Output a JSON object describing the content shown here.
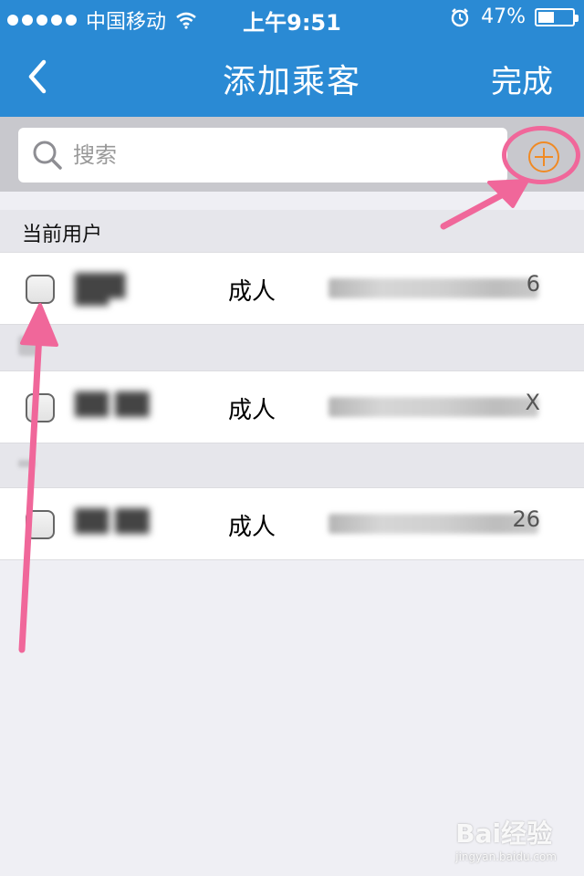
{
  "status_bar": {
    "carrier": "中国移动",
    "time": "上午9:51",
    "battery": "47%",
    "battery_level": 0.47
  },
  "nav": {
    "title": "添加乘客",
    "done_label": "完成"
  },
  "search": {
    "placeholder": "搜索"
  },
  "sections": {
    "current_user": "当前用户"
  },
  "passengers": [
    {
      "type": "成人",
      "id_tail": "6"
    },
    {
      "type": "成人",
      "id_tail": "X"
    },
    {
      "type": "成人",
      "id_tail": "26"
    }
  ],
  "icons": {
    "back": "chevron-left-icon",
    "search": "search-icon",
    "add": "plus-circle-icon"
  },
  "colors": {
    "header": "#2a8ad4",
    "accent": "#f08a24",
    "annotation": "#f0679a"
  },
  "watermark": {
    "brand": "Bai经验",
    "url": "jingyan.baidu.com"
  }
}
